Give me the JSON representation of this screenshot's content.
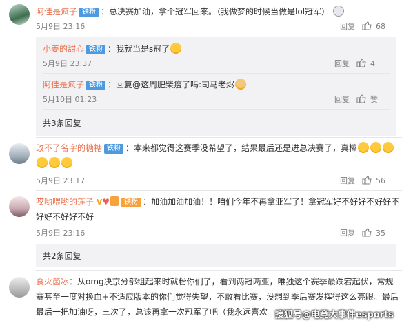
{
  "comments": [
    {
      "username": "阿佳是疯子",
      "badge": "铁粉",
      "text": "：总决赛加油，拿个冠军回来。（我做梦的时候当做是lol冠军）",
      "time": "5月9日 23:16",
      "reply_label": "回复",
      "like_count": "68",
      "replies": [
        {
          "username": "小姜的甜心",
          "badge": "铁粉",
          "text": "：我就当是s冠了",
          "time": "5月9日 23:37",
          "reply_label": "回复",
          "like_count": "4"
        },
        {
          "username": "阿佳是疯子",
          "badge": "铁粉",
          "text": "：回复@这周肥柴瘦了吗:司马老烬",
          "time": "5月10日 01:23",
          "reply_label": "回复",
          "like_count": "赞"
        }
      ],
      "more_replies": "共3条回复"
    },
    {
      "username": "改不了名字的糖糖",
      "badge": "铁粉",
      "text_line1": "：本来都觉得这赛季没希望了，结果最后还是进总决赛了，真棒",
      "time": "5月9日 23:17",
      "reply_label": "回复",
      "like_count": "56"
    },
    {
      "username": "哎哟喂哟的莲子",
      "badge": "铁粉",
      "text_line1": "：加油加油加油！！咱们今年不再拿亚军了！拿冠军好不好好不好好不",
      "text_line2": "好好不好好不好",
      "time": "5月9日 23:16",
      "reply_label": "回复",
      "like_count": "35",
      "more_replies": "共2条回复"
    },
    {
      "username": "食火菌冰",
      "text_line1": "：从omg决京分部组起来时就粉你们了，看到两冠两亚，唯独这个赛季最跌宕起伏，常规",
      "text_line2": "赛甚至一度对换血+不适应版本的你们觉得失望，不敢看比赛，没想到季后赛发挥得这么亮眼。最后",
      "text_line3": "最后一把加油呀，三次了，总该再拿一次冠军了吧（我永远喜欢"
    }
  ],
  "watermark": "搜狐号@电竞大事件esports",
  "colors": {
    "username": "#eb7350",
    "badge": "#4d9ae0",
    "sub_bg": "#f2f2f5",
    "meta": "#808080"
  },
  "icons": [
    "avatar",
    "thumb-up-icon",
    "emoji-icon",
    "gift-icon",
    "heart-icon",
    "v-icon"
  ]
}
